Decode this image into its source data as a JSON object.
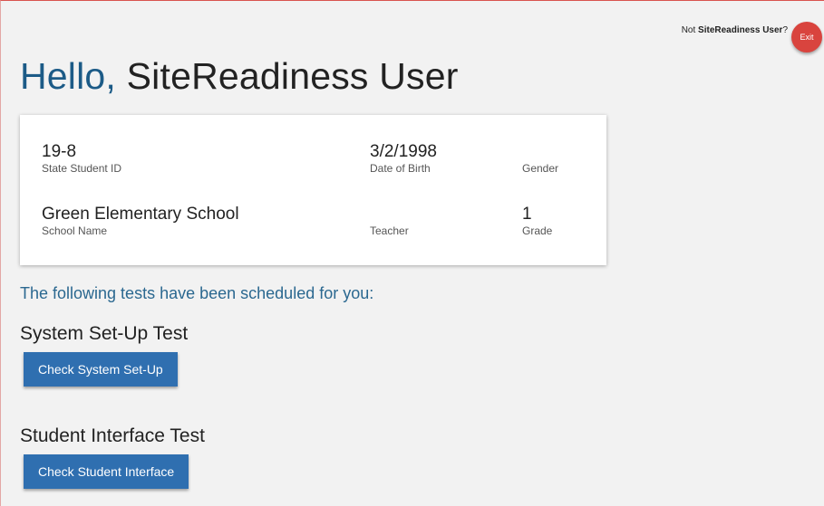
{
  "header": {
    "not_prefix": "Not ",
    "user_name": "SiteReadiness User",
    "not_suffix": "?",
    "exit_label": "Exit"
  },
  "greeting": {
    "hello": "Hello,",
    "name": "SiteReadiness User"
  },
  "student": {
    "state_id": {
      "value": "19-8",
      "label": "State Student ID"
    },
    "dob": {
      "value": "3/2/1998",
      "label": "Date of Birth"
    },
    "gender": {
      "value": "",
      "label": "Gender"
    },
    "school": {
      "value": "Green Elementary School",
      "label": "School Name"
    },
    "teacher": {
      "value": "",
      "label": "Teacher"
    },
    "grade": {
      "value": "1",
      "label": "Grade"
    }
  },
  "tests": {
    "intro": "The following tests have been scheduled for you:",
    "system": {
      "title": "System Set-Up Test",
      "button": "Check System Set-Up"
    },
    "interface": {
      "title": "Student Interface Test",
      "button": "Check Student Interface"
    }
  },
  "colors": {
    "accent": "#1c5b87",
    "button": "#2f6fb0",
    "exit": "#d9443e"
  }
}
